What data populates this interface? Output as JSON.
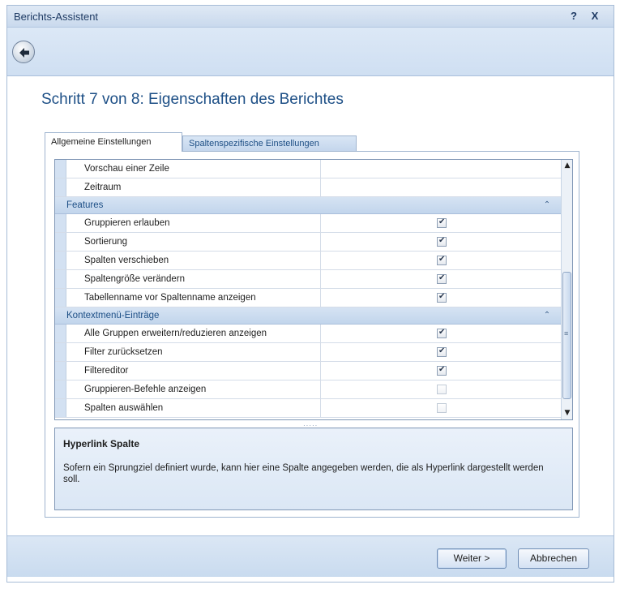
{
  "window": {
    "title": "Berichts-Assistent",
    "help_label": "?",
    "close_label": "X"
  },
  "header": {
    "step_title": "Schritt 7 von 8: Eigenschaften des Berichtes"
  },
  "tabs": [
    {
      "label": "Allgemeine Einstellungen",
      "active": true
    },
    {
      "label": "Spaltenspezifische Einstellungen",
      "active": false
    }
  ],
  "grid": {
    "rows_top": [
      {
        "label": "Vorschau einer Zeile"
      },
      {
        "label": "Zeitraum"
      }
    ],
    "categories": [
      {
        "label": "Features",
        "collapse_icon": "«",
        "rows": [
          {
            "label": "Gruppieren erlauben",
            "checked": true
          },
          {
            "label": "Sortierung",
            "checked": true
          },
          {
            "label": "Spalten verschieben",
            "checked": true
          },
          {
            "label": "Spaltengröße verändern",
            "checked": true
          },
          {
            "label": "Tabellenname vor Spaltenname anzeigen",
            "checked": true
          }
        ]
      },
      {
        "label": "Kontextmenü-Einträge",
        "collapse_icon": "«",
        "rows": [
          {
            "label": "Alle Gruppen erweitern/reduzieren anzeigen",
            "checked": true
          },
          {
            "label": "Filter zurücksetzen",
            "checked": true
          },
          {
            "label": "Filtereditor",
            "checked": true
          },
          {
            "label": "Gruppieren-Befehle anzeigen",
            "checked": false
          },
          {
            "label": "Spalten auswählen",
            "checked": false
          }
        ]
      }
    ]
  },
  "description": {
    "title": "Hyperlink Spalte",
    "text": "Sofern ein Sprungziel definiert wurde, kann hier eine Spalte angegeben werden, die als Hyperlink dargestellt werden soll."
  },
  "footer": {
    "next_label": "Weiter >",
    "cancel_label": "Abbrechen"
  },
  "icons": {
    "back": "back-arrow-icon",
    "scroll_up": "▲",
    "scroll_down": "▼",
    "thumb_grip": "≡",
    "splitter_grip": "·····"
  },
  "colors": {
    "accent": "#1d4f86",
    "header_bg": "#dce8f6",
    "category_bg": "#d6e3f3"
  }
}
